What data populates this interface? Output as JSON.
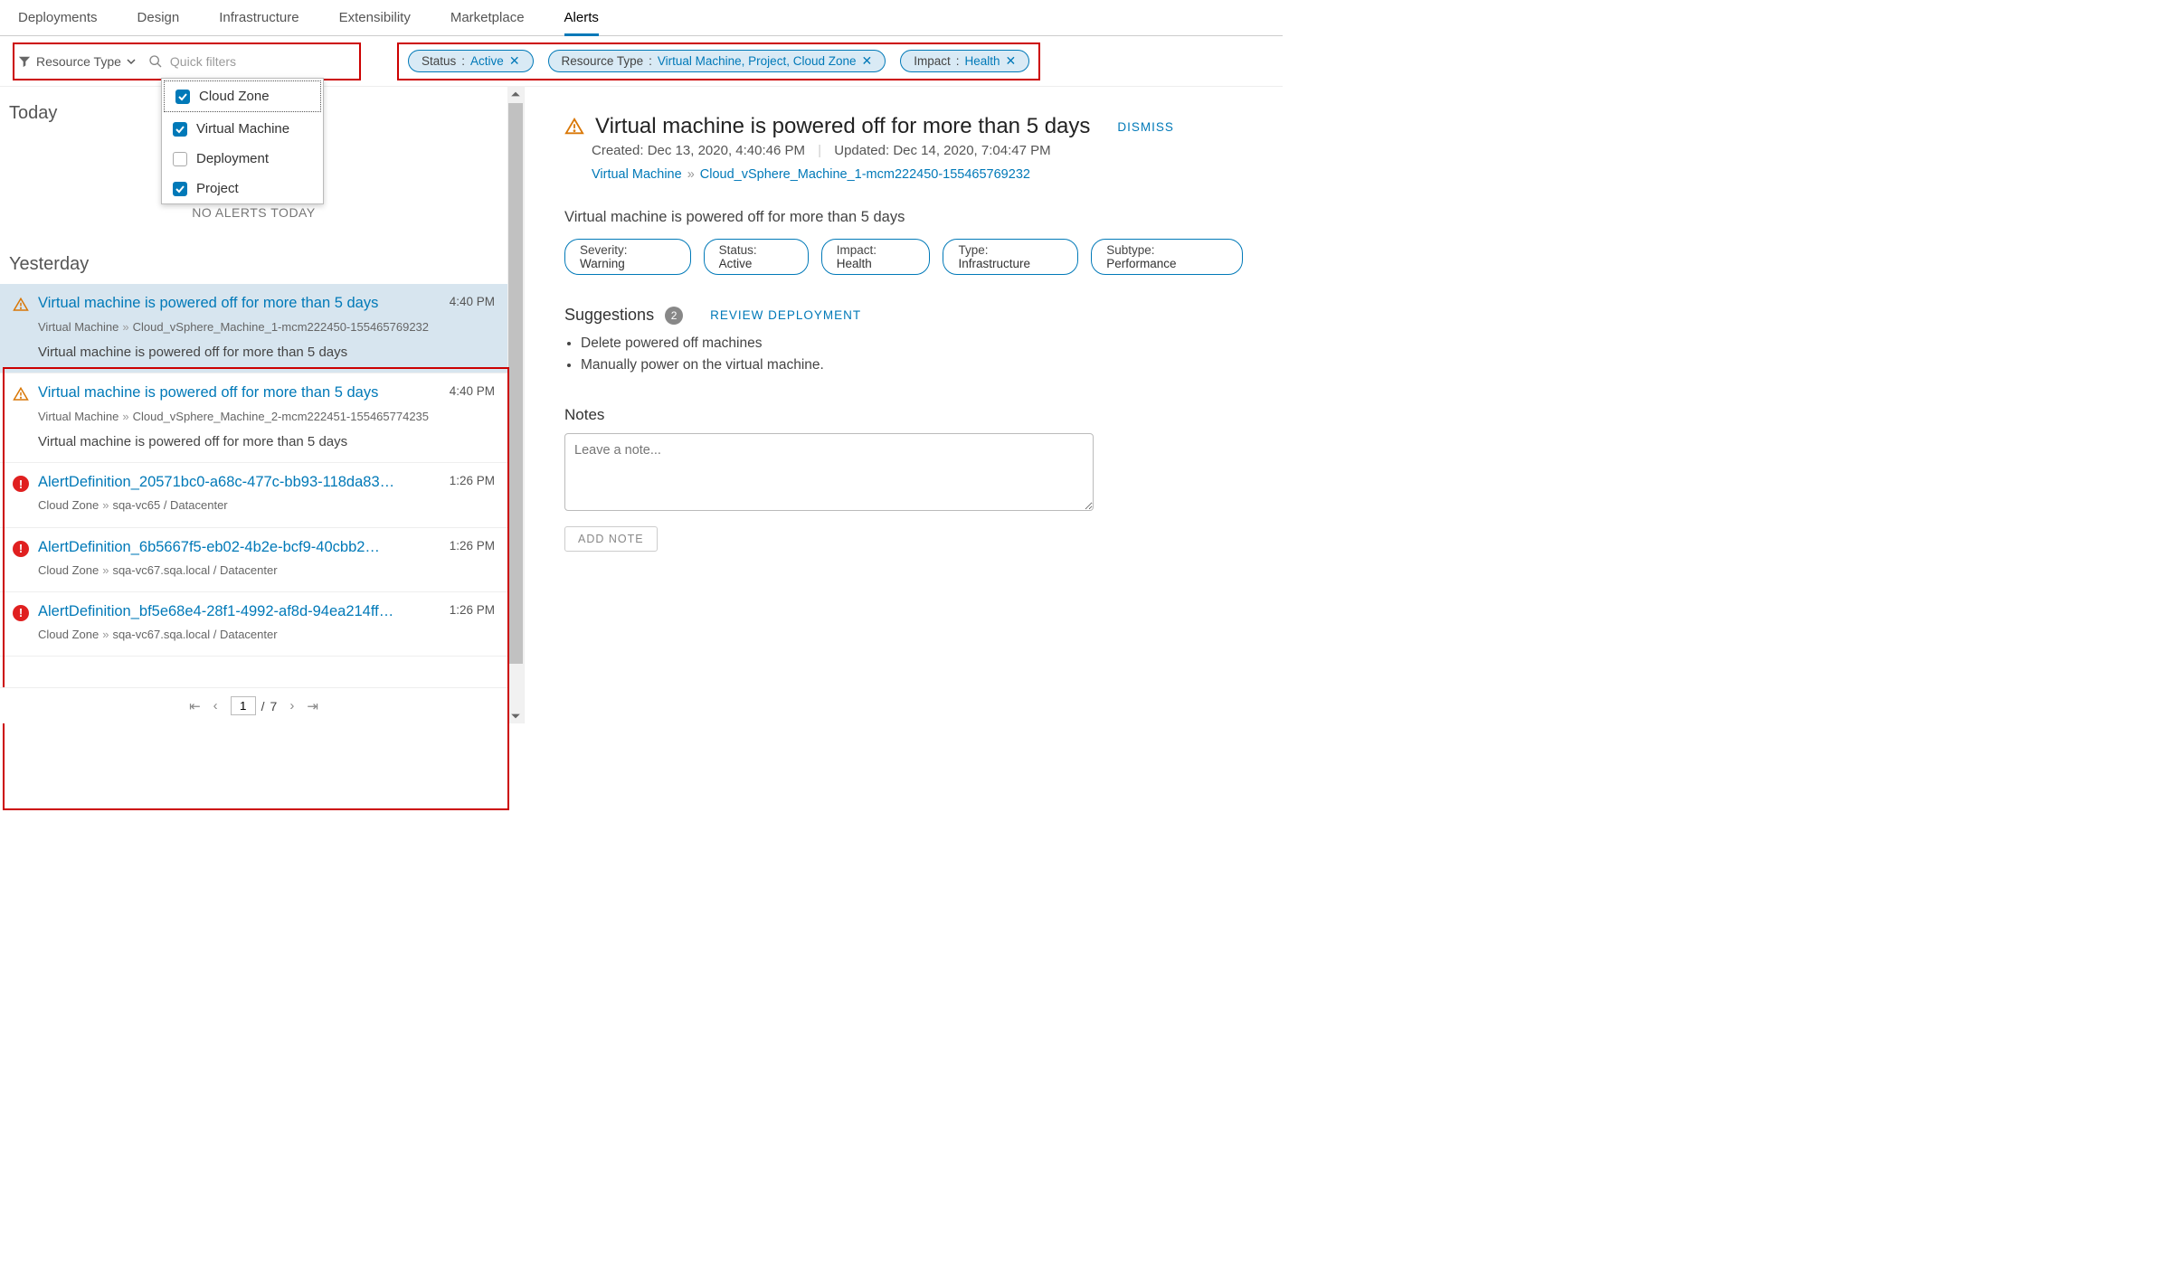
{
  "nav": {
    "tabs": [
      "Deployments",
      "Design",
      "Infrastructure",
      "Extensibility",
      "Marketplace",
      "Alerts"
    ],
    "active": "Alerts"
  },
  "filters": {
    "resourceTypeBtn": "Resource Type",
    "quickFiltersPlaceholder": "Quick filters",
    "dropdown": [
      {
        "label": "Cloud Zone",
        "checked": true
      },
      {
        "label": "Virtual Machine",
        "checked": true
      },
      {
        "label": "Deployment",
        "checked": false
      },
      {
        "label": "Project",
        "checked": true
      }
    ],
    "pills": [
      {
        "key": "Status",
        "value": "Active"
      },
      {
        "key": "Resource Type",
        "value": "Virtual Machine, Project, Cloud Zone"
      },
      {
        "key": "Impact",
        "value": "Health"
      }
    ]
  },
  "left": {
    "todayHeader": "Today",
    "todayEmptyMsg": "NO ALERTS TODAY",
    "yesterdayHeader": "Yesterday",
    "alerts": [
      {
        "severity": "warning",
        "selected": true,
        "title": "Virtual machine is powered off for more than 5 days",
        "time": "4:40 PM",
        "pathType": "Virtual Machine",
        "pathName": "Cloud_vSphere_Machine_1-mcm222450-155465769232",
        "desc": "Virtual machine is powered off for more than 5 days"
      },
      {
        "severity": "warning",
        "selected": false,
        "title": "Virtual machine is powered off for more than 5 days",
        "time": "4:40 PM",
        "pathType": "Virtual Machine",
        "pathName": "Cloud_vSphere_Machine_2-mcm222451-155465774235",
        "desc": "Virtual machine is powered off for more than 5 days"
      },
      {
        "severity": "critical",
        "selected": false,
        "title": "AlertDefinition_20571bc0-a68c-477c-bb93-118da83…",
        "time": "1:26 PM",
        "pathType": "Cloud Zone",
        "pathName": "sqa-vc65 / Datacenter"
      },
      {
        "severity": "critical",
        "selected": false,
        "title": "AlertDefinition_6b5667f5-eb02-4b2e-bcf9-40cbb2…",
        "time": "1:26 PM",
        "pathType": "Cloud Zone",
        "pathName": "sqa-vc67.sqa.local / Datacenter"
      },
      {
        "severity": "critical",
        "selected": false,
        "title": "AlertDefinition_bf5e68e4-28f1-4992-af8d-94ea214ff…",
        "time": "1:26 PM",
        "pathType": "Cloud Zone",
        "pathName": "sqa-vc67.sqa.local / Datacenter"
      }
    ],
    "pager": {
      "page": "1",
      "total": "7"
    }
  },
  "detail": {
    "title": "Virtual machine is powered off for more than 5 days",
    "dismiss": "DISMISS",
    "createdLabel": "Created:",
    "createdValue": "Dec 13, 2020, 4:40:46 PM",
    "updatedLabel": "Updated:",
    "updatedValue": "Dec 14, 2020, 7:04:47 PM",
    "bcType": "Virtual Machine",
    "bcName": "Cloud_vSphere_Machine_1-mcm222450-155465769232",
    "summary": "Virtual machine is powered off for more than 5 days",
    "tags": [
      {
        "key": "Severity",
        "value": "Warning"
      },
      {
        "key": "Status",
        "value": "Active"
      },
      {
        "key": "Impact",
        "value": "Health"
      },
      {
        "key": "Type",
        "value": "Infrastructure"
      },
      {
        "key": "Subtype",
        "value": "Performance"
      }
    ],
    "suggHeader": "Suggestions",
    "suggCount": "2",
    "reviewBtn": "REVIEW DEPLOYMENT",
    "suggestions": [
      "Delete powered off machines",
      "Manually power on the virtual machine."
    ],
    "notesHeader": "Notes",
    "notesPlaceholder": "Leave a note...",
    "addNoteBtn": "ADD NOTE"
  }
}
